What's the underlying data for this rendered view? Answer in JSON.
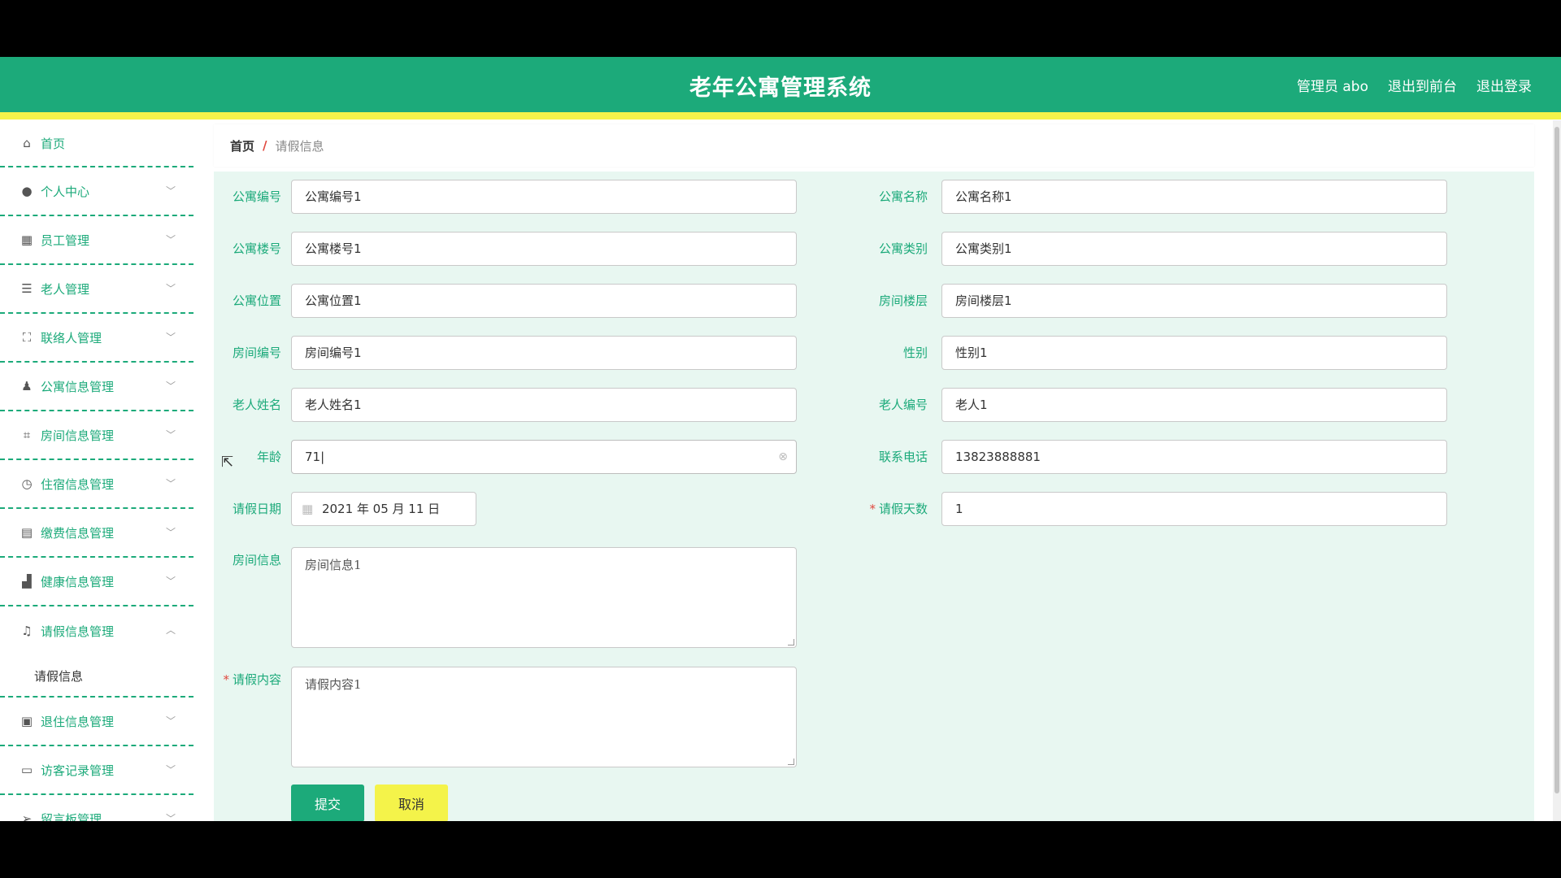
{
  "header": {
    "title": "老年公寓管理系统",
    "user": "管理员 abo",
    "to_front": "退出到前台",
    "logout": "退出登录"
  },
  "sidebar": {
    "items": [
      {
        "label": "首页",
        "icon": "home-icon"
      },
      {
        "label": "个人中心",
        "icon": "person-icon"
      },
      {
        "label": "员工管理",
        "icon": "grid-icon"
      },
      {
        "label": "老人管理",
        "icon": "list-icon"
      },
      {
        "label": "联络人管理",
        "icon": "frame-icon"
      },
      {
        "label": "公寓信息管理",
        "icon": "stamp-icon"
      },
      {
        "label": "房间信息管理",
        "icon": "crop-icon"
      },
      {
        "label": "住宿信息管理",
        "icon": "clock-icon"
      },
      {
        "label": "缴费信息管理",
        "icon": "clipboard-icon"
      },
      {
        "label": "健康信息管理",
        "icon": "bar-chart-icon"
      },
      {
        "label": "请假信息管理",
        "icon": "bell-off-icon"
      },
      {
        "label": "退住信息管理",
        "icon": "checklist-icon"
      },
      {
        "label": "访客记录管理",
        "icon": "id-card-icon"
      },
      {
        "label": "留言板管理",
        "icon": "send-icon"
      }
    ],
    "active_submenu": "请假信息"
  },
  "breadcrumb": {
    "home": "首页",
    "separator": "/",
    "current": "请假信息"
  },
  "form": {
    "apartment_no": {
      "label": "公寓编号",
      "value": "公寓编号1"
    },
    "apartment_name": {
      "label": "公寓名称",
      "value": "公寓名称1"
    },
    "building_no": {
      "label": "公寓楼号",
      "value": "公寓楼号1"
    },
    "apartment_type": {
      "label": "公寓类别",
      "value": "公寓类别1"
    },
    "location": {
      "label": "公寓位置",
      "value": "公寓位置1"
    },
    "room_floor": {
      "label": "房间楼层",
      "value": "房间楼层1"
    },
    "room_no": {
      "label": "房间编号",
      "value": "房间编号1"
    },
    "gender": {
      "label": "性别",
      "value": "性别1"
    },
    "elder_name": {
      "label": "老人姓名",
      "value": "老人姓名1"
    },
    "elder_no": {
      "label": "老人编号",
      "value": "老人1"
    },
    "age": {
      "label": "年龄",
      "value": "71|"
    },
    "phone": {
      "label": "联系电话",
      "value": "13823888881"
    },
    "leave_date": {
      "label": "请假日期",
      "value": "2021 年 05 月 11 日"
    },
    "leave_days": {
      "label": "请假天数",
      "value": "1",
      "required_mark": "*"
    },
    "room_info": {
      "label": "房间信息",
      "value": "房间信息1"
    },
    "leave_content": {
      "label": "请假内容",
      "value": "请假内容1",
      "required_mark": "*"
    },
    "submit_label": "提交",
    "cancel_label": "取消"
  },
  "colors": {
    "primary": "#1caa7a",
    "accent_yellow": "#f4f34a",
    "content_bg": "#e8f7f1",
    "required": "#e0473d"
  }
}
